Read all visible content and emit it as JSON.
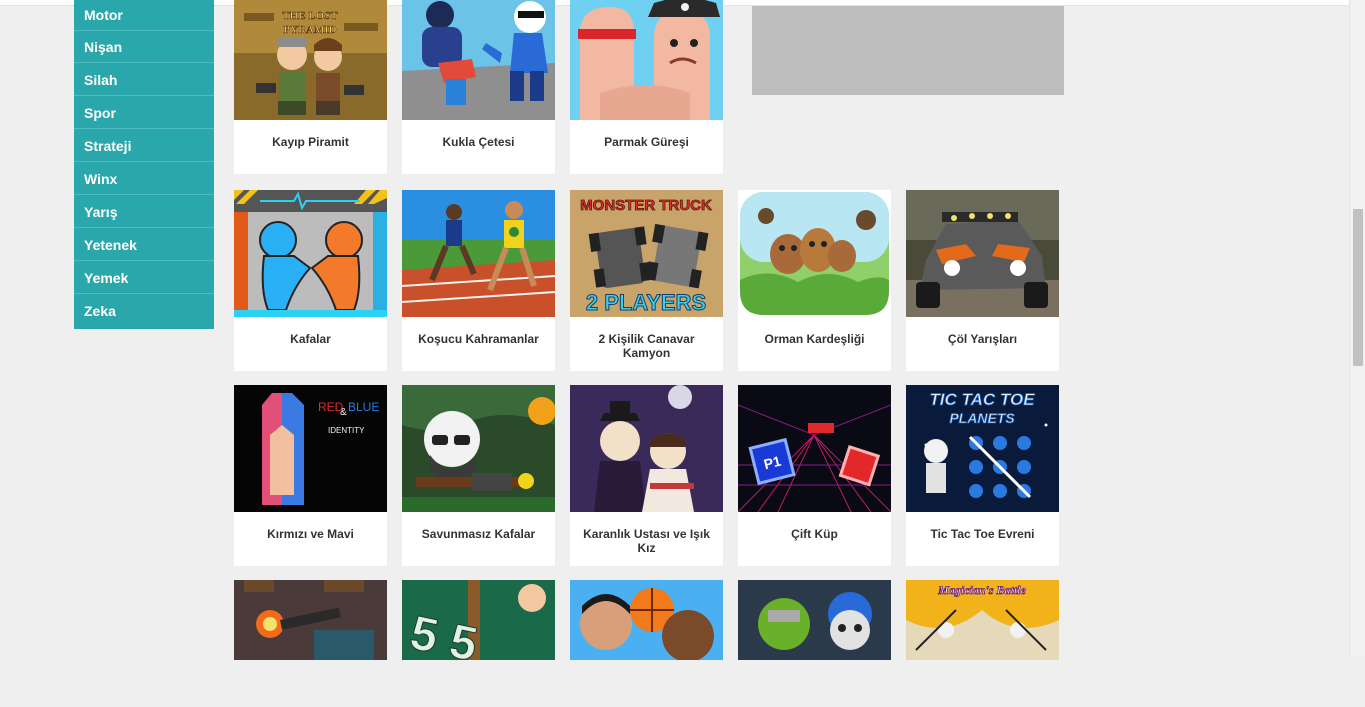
{
  "sidebar": {
    "items": [
      {
        "label": "Motor"
      },
      {
        "label": "Nişan"
      },
      {
        "label": "Silah"
      },
      {
        "label": "Spor"
      },
      {
        "label": "Strateji"
      },
      {
        "label": "Winx"
      },
      {
        "label": "Yarış"
      },
      {
        "label": "Yetenek"
      },
      {
        "label": "Yemek"
      },
      {
        "label": "Zeka"
      }
    ]
  },
  "games": {
    "row1": [
      {
        "title": "Kayıp Piramit",
        "thumb_text": "THE LOST PYRAMID"
      },
      {
        "title": "Kukla Çetesi"
      },
      {
        "title": "Parmak Güreşi"
      }
    ],
    "row2": [
      {
        "title": "Kafalar"
      },
      {
        "title": "Koşucu Kahramanlar"
      },
      {
        "title": "2 Kişilik Canavar Kamyon",
        "thumb_text_top": "MONSTER TRUCK",
        "thumb_text_bottom": "2 PLAYERS"
      },
      {
        "title": "Orman Kardeşliği"
      },
      {
        "title": "Çöl Yarışları"
      }
    ],
    "row3": [
      {
        "title": "Kırmızı ve Mavi",
        "thumb_text_red": "RED",
        "thumb_text_amp": "&",
        "thumb_text_blue": "BLUE",
        "thumb_text_sub": "IDENTITY"
      },
      {
        "title": "Savunmasız Kafalar"
      },
      {
        "title": "Karanlık Ustası ve Işık Kız"
      },
      {
        "title": "Çift Küp",
        "thumb_text": "P1"
      },
      {
        "title": "Tic Tac Toe Evreni",
        "thumb_text_1": "TIC TAC TOE",
        "thumb_text_2": "PLANETS"
      }
    ],
    "row4": [
      {
        "title": ""
      },
      {
        "title": "",
        "thumb_text": "5 5"
      },
      {
        "title": ""
      },
      {
        "title": ""
      },
      {
        "title": "",
        "thumb_text": "Magician's Battle"
      }
    ]
  },
  "colors": {
    "sidebar_bg": "#2aa7ab",
    "page_bg": "#efefef",
    "ad_placeholder": "#bdbdbd"
  }
}
